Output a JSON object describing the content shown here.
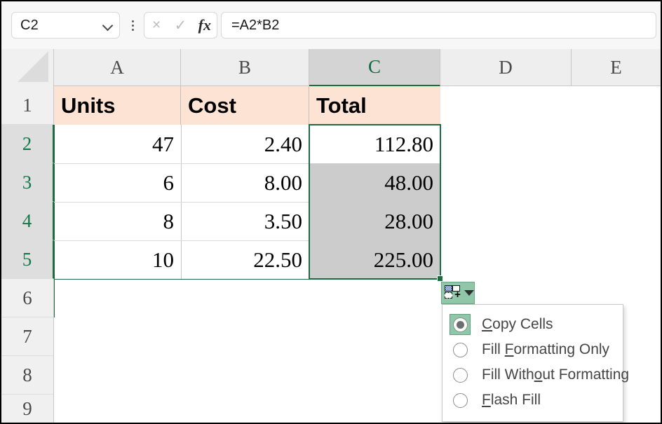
{
  "app": {
    "name": "Microsoft Excel",
    "screen": "autofill-options-dropdown"
  },
  "formula_bar": {
    "name_box_value": "C2",
    "name_box_dropdown_icon": "chevron-down-icon",
    "more_options_icon": "kebab-menu-icon",
    "cancel_icon": "×",
    "cancel_icon_name": "cancel-icon",
    "confirm_icon": "✓",
    "confirm_icon_name": "confirm-checkmark-icon",
    "function_icon": "fx",
    "function_icon_name": "insert-function-icon",
    "formula_value": "=A2*B2",
    "formula_placeholder": ""
  },
  "sheet": {
    "select_all_icon": "select-all-triangle-icon",
    "column_headers": [
      "A",
      "B",
      "C",
      "D",
      "E"
    ],
    "selected_column": "C",
    "row_headers": [
      "1",
      "2",
      "3",
      "4",
      "5",
      "6",
      "7",
      "8",
      "9"
    ],
    "selected_rows": [
      "2",
      "3",
      "4",
      "5"
    ],
    "active_cell": "C2",
    "selected_range": "C2:C5",
    "header_row": {
      "a": "Units",
      "b": "Cost",
      "c": "Total"
    },
    "rows": [
      {
        "row": "2",
        "a": "47",
        "b": "2.40",
        "c": "112.80"
      },
      {
        "row": "3",
        "a": "6",
        "b": "8.00",
        "c": "48.00"
      },
      {
        "row": "4",
        "a": "8",
        "b": "3.50",
        "c": "28.00"
      },
      {
        "row": "5",
        "a": "10",
        "b": "22.50",
        "c": "225.00"
      }
    ],
    "colors": {
      "header_fill": "#fce3d4",
      "selection_border": "#1e6b41",
      "range_shade": "#cccccc",
      "row_header_selected": "#dedede"
    }
  },
  "autofill": {
    "button_icon_name": "autofill-options-icon",
    "button_arrow_icon": "chevron-down-icon",
    "button_color": "#8fc7a8",
    "menu": {
      "selected_option": "Copy Cells",
      "options": [
        {
          "label": "Copy Cells",
          "accel_before": "",
          "accel": "C",
          "accel_after": "opy Cells",
          "checked": true
        },
        {
          "label": "Fill Formatting Only",
          "accel_before": "Fill ",
          "accel": "F",
          "accel_after": "ormatting Only",
          "checked": false
        },
        {
          "label": "Fill Without Formatting",
          "accel_before": "Fill With",
          "accel": "o",
          "accel_after": "ut Formatting",
          "checked": false
        },
        {
          "label": "Flash Fill",
          "accel_before": "",
          "accel": "F",
          "accel_after": "lash Fill",
          "checked": false
        }
      ]
    }
  }
}
